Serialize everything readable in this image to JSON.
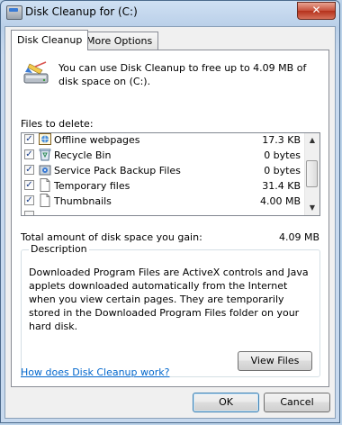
{
  "window": {
    "title": "Disk Cleanup for  (C:)",
    "close_symbol": "✕"
  },
  "tabs": [
    {
      "label": "Disk Cleanup",
      "active": true
    },
    {
      "label": "More Options",
      "active": false
    }
  ],
  "intro_text": "You can use Disk Cleanup to free up to 4.09 MB of disk space on  (C:).",
  "files_label": "Files to delete:",
  "files": [
    {
      "name": "Offline webpages",
      "size": "17.3 KB",
      "checked": true,
      "icon": "offline-webpages-icon"
    },
    {
      "name": "Recycle Bin",
      "size": "0 bytes",
      "checked": true,
      "icon": "recycle-bin-icon"
    },
    {
      "name": "Service Pack Backup Files",
      "size": "0 bytes",
      "checked": true,
      "icon": "service-pack-icon"
    },
    {
      "name": "Temporary files",
      "size": "31.4 KB",
      "checked": true,
      "icon": "file-icon"
    },
    {
      "name": "Thumbnails",
      "size": "4.00 MB",
      "checked": true,
      "icon": "file-icon"
    }
  ],
  "total": {
    "label": "Total amount of disk space you gain:",
    "value": "4.09 MB"
  },
  "description": {
    "title": "Description",
    "text": "Downloaded Program Files are ActiveX controls and Java applets downloaded automatically from the Internet when you view certain pages. They are temporarily stored in the Downloaded Program Files folder on your hard disk."
  },
  "view_files_label": "View Files",
  "help_link": "How does Disk Cleanup work?",
  "ok_label": "OK",
  "cancel_label": "Cancel",
  "colors": {
    "link": "#0066cc",
    "accent_border": "#3c7fb1"
  }
}
